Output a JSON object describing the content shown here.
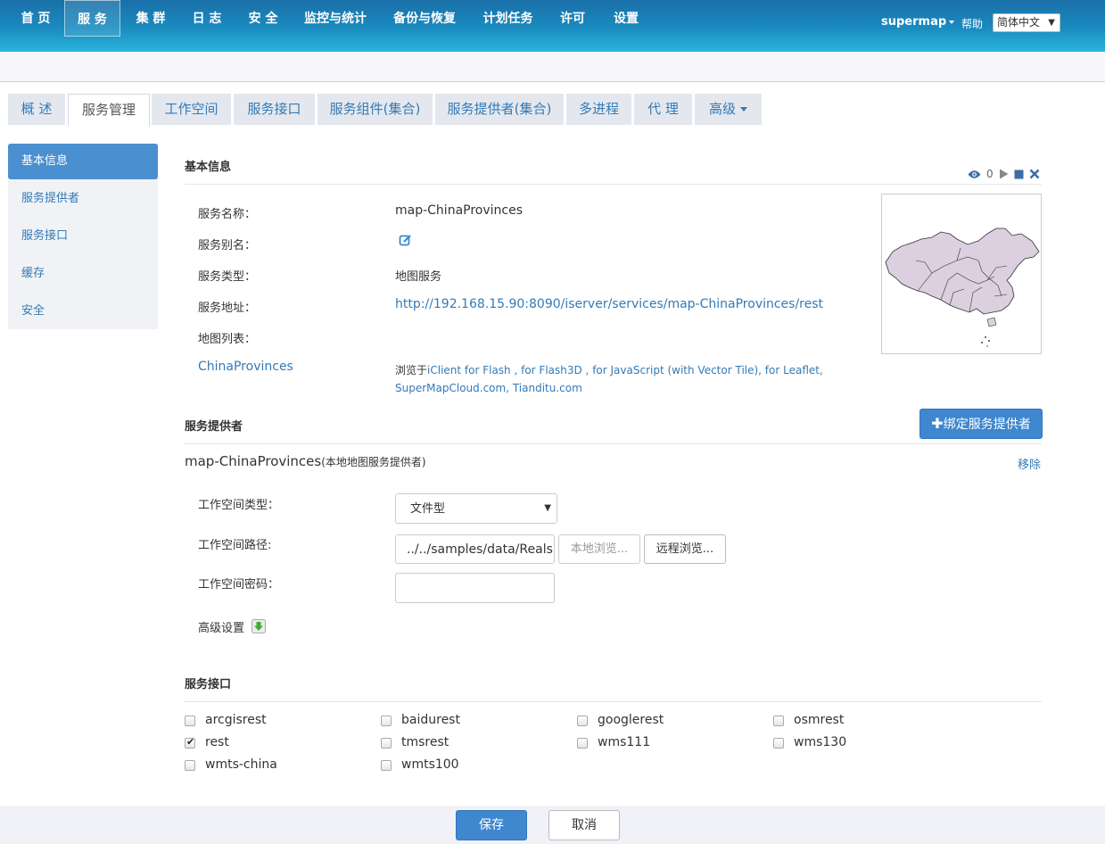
{
  "nav": {
    "items": [
      "首 页",
      "服 务",
      "集 群",
      "日 志",
      "安 全",
      "监控与统计",
      "备份与恢复",
      "计划任务",
      "许可",
      "设置"
    ],
    "user": "supermap",
    "help": "帮助",
    "language": "简体中文"
  },
  "tabs": [
    "概 述",
    "服务管理",
    "工作空间",
    "服务接口",
    "服务组件(集合)",
    "服务提供者(集合)",
    "多进程",
    "代 理",
    "高级"
  ],
  "sidebar": [
    "基本信息",
    "服务提供者",
    "服务接口",
    "缓存",
    "安全"
  ],
  "basic": {
    "title": "基本信息",
    "view_count": "0",
    "name_label": "服务名称：",
    "name_value": "map-ChinaProvinces",
    "alias_label": "服务别名：",
    "type_label": "服务类型：",
    "type_value": "地图服务",
    "address_label": "服务地址：",
    "address_value": "http://192.168.15.90:8090/iserver/services/map-ChinaProvinces/rest",
    "maplist_label": "地图列表：",
    "map_name": "ChinaProvinces",
    "browse_prefix": "浏览于",
    "browse_line1": "iClient for Flash , for Flash3D , for JavaScript (with Vector Tile), for Leaflet,",
    "browse_line2": "SuperMapCloud.com, Tianditu.com"
  },
  "provider": {
    "title": "服务提供者",
    "bind_button": "绑定服务提供者",
    "name": "map-ChinaProvinces",
    "name_suffix": "(本地地图服务提供者)",
    "remove": "移除",
    "ws_type_label": "工作空间类型：",
    "ws_type_value": "文件型",
    "ws_path_label": "工作空间路径:",
    "ws_path_value": "../../samples/data/RealspaceSample/China/China.smwu",
    "local_browse": "本地浏览...",
    "remote_browse": "远程浏览...",
    "ws_password_label": "工作空间密码：",
    "advanced_label": "高级设置"
  },
  "interfaces": {
    "title": "服务接口",
    "items": [
      {
        "name": "arcgisrest",
        "checked": false
      },
      {
        "name": "baidurest",
        "checked": false
      },
      {
        "name": "googlerest",
        "checked": false
      },
      {
        "name": "osmrest",
        "checked": false
      },
      {
        "name": "rest",
        "checked": true
      },
      {
        "name": "tmsrest",
        "checked": false
      },
      {
        "name": "wms111",
        "checked": false
      },
      {
        "name": "wms130",
        "checked": false
      },
      {
        "name": "wmts-china",
        "checked": false
      },
      {
        "name": "wmts100",
        "checked": false
      }
    ]
  },
  "footer": {
    "save": "保存",
    "cancel": "取消"
  },
  "colors": {
    "accent": "#3f87cf",
    "nav_top": "#1a6fa8",
    "nav_bottom": "#29b5dc",
    "map_fill": "#dccfe0"
  }
}
